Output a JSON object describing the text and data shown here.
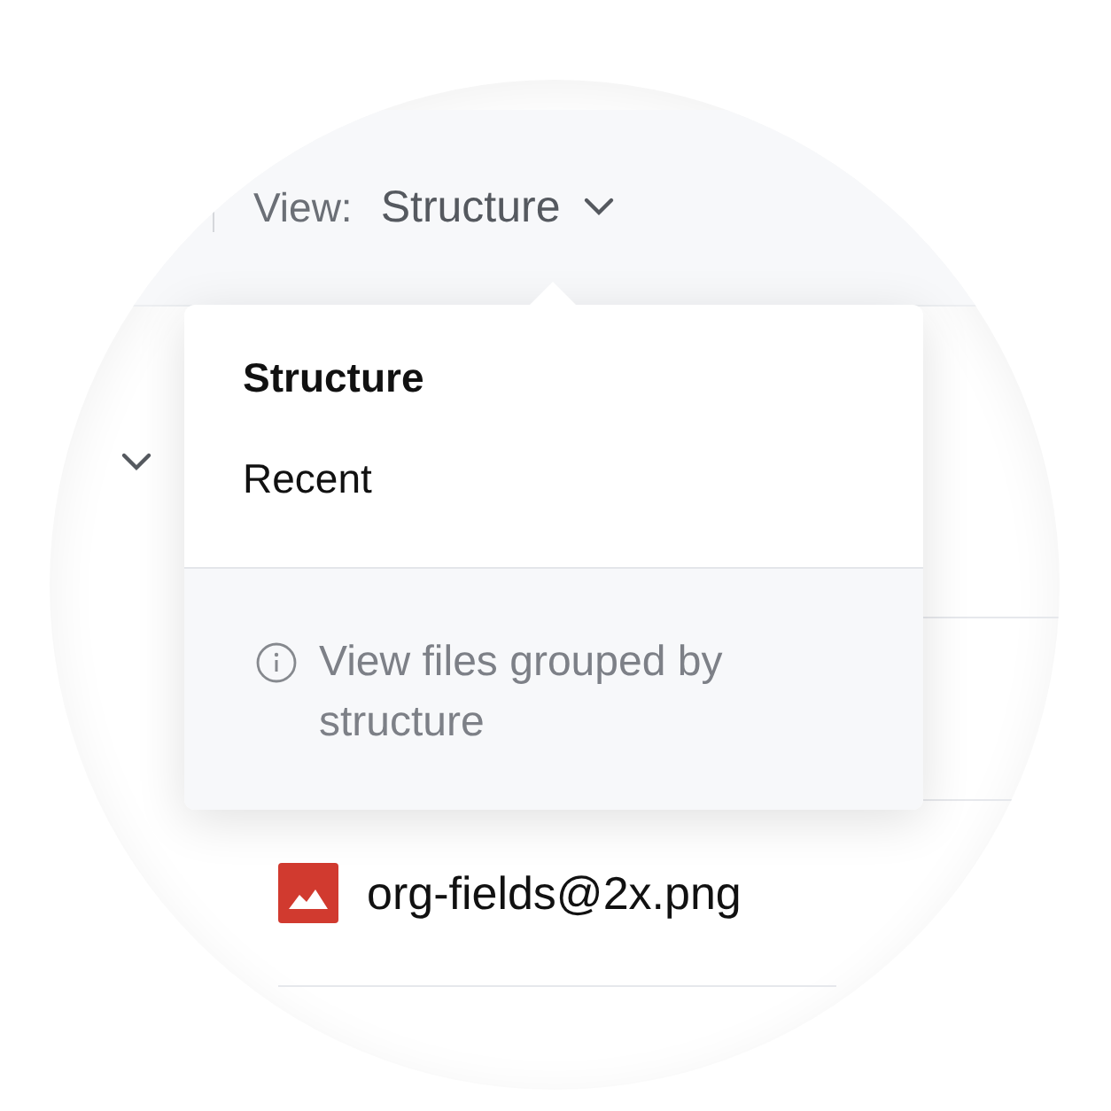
{
  "view_selector": {
    "label": "View:",
    "value": "Structure"
  },
  "tree_toggle": {
    "expanded": true
  },
  "files": [
    {
      "name": "org-fields@2x.png"
    }
  ],
  "menu": {
    "items": [
      {
        "label": "Structure",
        "selected": true
      },
      {
        "label": "Recent",
        "selected": false
      }
    ],
    "hint": "View files grouped by structure"
  }
}
